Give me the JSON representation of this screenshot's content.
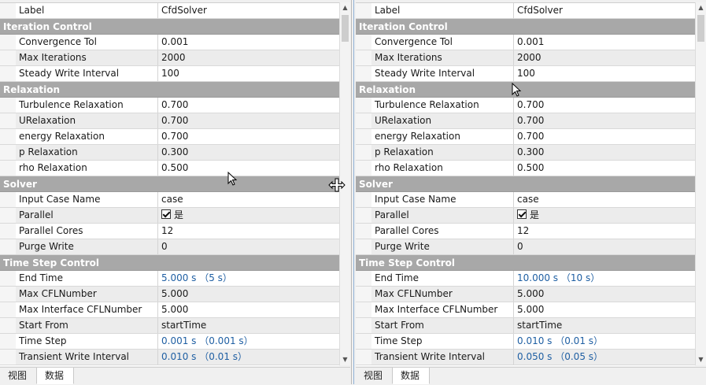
{
  "left": {
    "label_row": {
      "key": "Label",
      "value": "CfdSolver"
    },
    "iteration": {
      "title": "Iteration Control",
      "convergence": {
        "key": "Convergence Tol",
        "value": "0.001"
      },
      "max_iter": {
        "key": "Max Iterations",
        "value": "2000"
      },
      "steady_write": {
        "key": "Steady Write Interval",
        "value": "100"
      }
    },
    "relaxation": {
      "title": "Relaxation",
      "turbulence": {
        "key": "Turbulence Relaxation",
        "value": "0.700"
      },
      "u": {
        "key": "URelaxation",
        "value": "0.700"
      },
      "energy": {
        "key": "energy Relaxation",
        "value": "0.700"
      },
      "p": {
        "key": "p Relaxation",
        "value": "0.300"
      },
      "rho": {
        "key": "rho Relaxation",
        "value": "0.500"
      }
    },
    "solver": {
      "title": "Solver",
      "case_name": {
        "key": "Input Case Name",
        "value": "case"
      },
      "parallel": {
        "key": "Parallel",
        "value": "是"
      },
      "cores": {
        "key": "Parallel Cores",
        "value": "12"
      },
      "purge": {
        "key": "Purge Write",
        "value": "0"
      }
    },
    "timestep": {
      "title": "Time Step Control",
      "end_time": {
        "key": "End Time",
        "value": "5.000 s （5 s）"
      },
      "max_cfl": {
        "key": "Max CFLNumber",
        "value": "5.000"
      },
      "max_iface_cfl": {
        "key": "Max Interface CFLNumber",
        "value": "5.000"
      },
      "start_from": {
        "key": "Start From",
        "value": "startTime"
      },
      "time_step": {
        "key": "Time Step",
        "value": "0.001 s （0.001 s）"
      },
      "transient_write": {
        "key": "Transient Write Interval",
        "value": "0.010 s （0.01 s）"
      }
    },
    "tabs": {
      "view": "视图",
      "data": "数据"
    }
  },
  "right": {
    "label_row": {
      "key": "Label",
      "value": "CfdSolver"
    },
    "iteration": {
      "title": "Iteration Control",
      "convergence": {
        "key": "Convergence Tol",
        "value": "0.001"
      },
      "max_iter": {
        "key": "Max Iterations",
        "value": "2000"
      },
      "steady_write": {
        "key": "Steady Write Interval",
        "value": "100"
      }
    },
    "relaxation": {
      "title": "Relaxation",
      "turbulence": {
        "key": "Turbulence Relaxation",
        "value": "0.700"
      },
      "u": {
        "key": "URelaxation",
        "value": "0.700"
      },
      "energy": {
        "key": "energy Relaxation",
        "value": "0.700"
      },
      "p": {
        "key": "p Relaxation",
        "value": "0.300"
      },
      "rho": {
        "key": "rho Relaxation",
        "value": "0.500"
      }
    },
    "solver": {
      "title": "Solver",
      "case_name": {
        "key": "Input Case Name",
        "value": "case"
      },
      "parallel": {
        "key": "Parallel",
        "value": "是"
      },
      "cores": {
        "key": "Parallel Cores",
        "value": "12"
      },
      "purge": {
        "key": "Purge Write",
        "value": "0"
      }
    },
    "timestep": {
      "title": "Time Step Control",
      "end_time": {
        "key": "End Time",
        "value": "10.000 s （10 s）"
      },
      "max_cfl": {
        "key": "Max CFLNumber",
        "value": "5.000"
      },
      "max_iface_cfl": {
        "key": "Max Interface CFLNumber",
        "value": "5.000"
      },
      "start_from": {
        "key": "Start From",
        "value": "startTime"
      },
      "time_step": {
        "key": "Time Step",
        "value": "0.010 s （0.01 s）"
      },
      "transient_write": {
        "key": "Transient Write Interval",
        "value": "0.050 s （0.05 s）"
      }
    },
    "tabs": {
      "view": "视图",
      "data": "数据"
    }
  },
  "colors": {
    "category_bg": "#a8a8a8",
    "unit_value": "#1f5fa3",
    "alt_row": "#ececec"
  }
}
